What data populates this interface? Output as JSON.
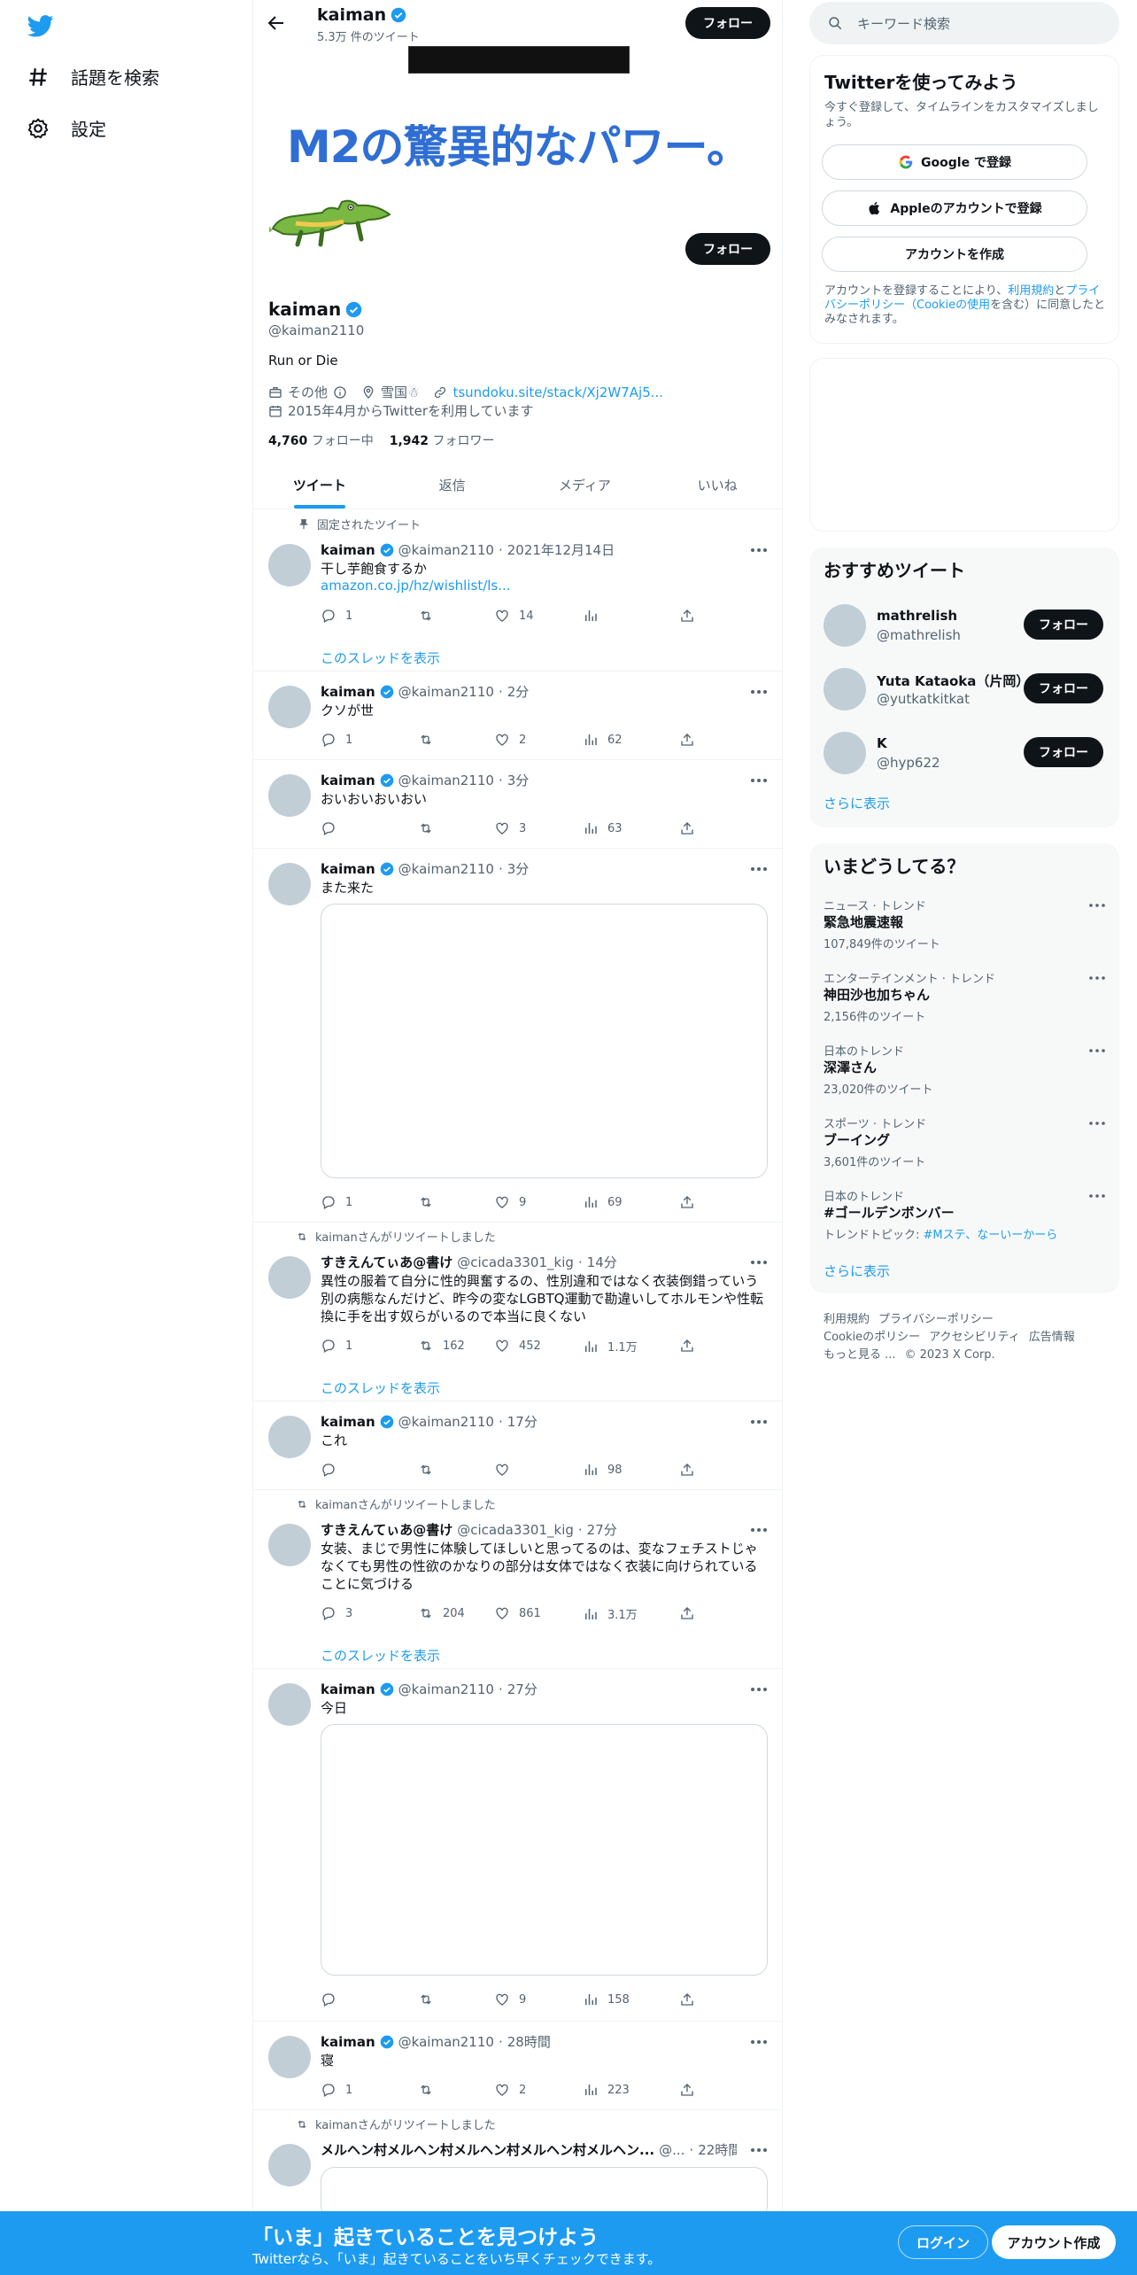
{
  "nav": {
    "explore_label": "話題を検索",
    "settings_label": "設定"
  },
  "profile": {
    "top_name": "kaiman",
    "tweet_count": "5.3万 件のツイート",
    "follow_label": "フォロー",
    "banner_text": "M2の驚異的なパワー。",
    "name": "kaiman",
    "handle": "@kaiman2110",
    "bio": "Run or Die",
    "category": "その他",
    "location": "雪国☃",
    "website": "tsundoku.site/stack/Xj2W7Aj5...",
    "joined": "2015年4月からTwitterを利用しています",
    "following_count": "4,760",
    "following_label": "フォロー中",
    "followers_count": "1,942",
    "followers_label": "フォロワー"
  },
  "tabs": [
    "ツイート",
    "返信",
    "メディア",
    "いいね"
  ],
  "tweets": [
    {
      "context": "固定されたツイート",
      "name": "kaiman",
      "handle": "@kaiman2110",
      "time": "2021年12月14日",
      "text": "干し芋飽食するか",
      "link": "amazon.co.jp/hz/wishlist/ls...",
      "replies": "1",
      "retweets": "",
      "likes": "14",
      "views": "",
      "show_thread": "このスレッドを表示"
    },
    {
      "name": "kaiman",
      "handle": "@kaiman2110",
      "time": "2分",
      "text": "クソが世",
      "replies": "1",
      "retweets": "",
      "likes": "2",
      "views": "62"
    },
    {
      "name": "kaiman",
      "handle": "@kaiman2110",
      "time": "3分",
      "text": "おいおいおいおい",
      "replies": "",
      "retweets": "",
      "likes": "3",
      "views": "63"
    },
    {
      "name": "kaiman",
      "handle": "@kaiman2110",
      "time": "3分",
      "text": "また来た",
      "replies": "1",
      "retweets": "",
      "likes": "9",
      "views": "69"
    },
    {
      "context": "kaimanさんがリツイートしました",
      "name": "すきえんてぃあ@書け",
      "handle": "@cicada3301_kig",
      "time": "14分",
      "text": "異性の服着て自分に性的興奮するの、性別違和ではなく衣装倒錯っていう別の病態なんだけど、昨今の変なLGBTQ運動で勘違いしてホルモンや性転換に手を出す奴らがいるので本当に良くない",
      "replies": "1",
      "retweets": "162",
      "likes": "452",
      "views": "1.1万",
      "show_thread": "このスレッドを表示"
    },
    {
      "name": "kaiman",
      "handle": "@kaiman2110",
      "time": "17分",
      "text": "これ",
      "replies": "",
      "retweets": "",
      "likes": "",
      "views": "98"
    },
    {
      "context": "kaimanさんがリツイートしました",
      "name": "すきえんてぃあ@書け",
      "handle": "@cicada3301_kig",
      "time": "27分",
      "text": "女装、まじで男性に体験してほしいと思ってるのは、変なフェチストじゃなくても男性の性欲のかなりの部分は女体ではなく衣装に向けられていることに気づける",
      "replies": "3",
      "retweets": "204",
      "likes": "861",
      "views": "3.1万",
      "show_thread": "このスレッドを表示"
    },
    {
      "name": "kaiman",
      "handle": "@kaiman2110",
      "time": "27分",
      "text": "今日",
      "replies": "",
      "retweets": "",
      "likes": "9",
      "views": "158"
    },
    {
      "name": "kaiman",
      "handle": "@kaiman2110",
      "time": "28時間",
      "text": "寝",
      "replies": "1",
      "retweets": "",
      "likes": "2",
      "views": "223"
    },
    {
      "context": "kaimanさんがリツイートしました",
      "name": "メルヘン村メルヘン村メルヘン村メルヘン村メルヘン...",
      "handle": "@...",
      "time": "22時間"
    }
  ],
  "search": {
    "placeholder": "キーワード検索"
  },
  "signup": {
    "title": "Twitterを使ってみよう",
    "subtitle": "今すぐ登録して、タイムラインをカスタマイズしましょう。",
    "google": "Google で登録",
    "apple": "Appleのアカウントで登録",
    "create": "アカウントを作成",
    "legal_prefix": "アカウントを登録することにより、",
    "legal_terms": "利用規約",
    "legal_and": "と",
    "legal_privacy": "プライバシーポリシー（Cookieの使用",
    "legal_suffix": "を含む）に同意したとみなされます。"
  },
  "recommend": {
    "title": "おすすめツイート",
    "accounts": [
      {
        "name": "mathrelish",
        "handle": "@mathrelish"
      },
      {
        "name": "Yuta Kataoka（片岡）",
        "handle": "@yutkatkitkat"
      },
      {
        "name": "K",
        "handle": "@hyp622"
      }
    ],
    "follow_label": "フォロー",
    "more": "さらに表示"
  },
  "trends": {
    "title": "いまどうしてる？",
    "items": [
      {
        "category": "ニュース · トレンド",
        "name": "緊急地震速報",
        "count": "107,849件のツイート"
      },
      {
        "category": "エンターテインメント · トレンド",
        "name": "神田沙也加ちゃん",
        "count": "2,156件のツイート"
      },
      {
        "category": "日本のトレンド",
        "name": "深澤さん",
        "count": "23,020件のツイート"
      },
      {
        "category": "スポーツ · トレンド",
        "name": "ブーイング",
        "count": "3,601件のツイート"
      },
      {
        "category": "日本のトレンド",
        "name": "#ゴールデンボンバー",
        "count_prefix": "トレンドトピック: ",
        "count_link": "#Mステ、なーいーかーら"
      }
    ],
    "more": "さらに表示"
  },
  "footer": {
    "links": [
      "利用規約",
      "プライバシーポリシー",
      "Cookieのポリシー",
      "アクセシビリティ",
      "広告情報",
      "もっと見る ...",
      "© 2023 X Corp."
    ]
  },
  "bottom": {
    "title": "「いま」起きていることを見つけよう",
    "subtitle": "Twitterなら、「いま」起きていることをいち早くチェックできます。",
    "login": "ログイン",
    "signup": "アカウント作成"
  },
  "colors": {
    "accent": "#1d9bf0",
    "dark": "#0f1419",
    "gray": "#536471",
    "banner_text": "#2f6ed4"
  }
}
